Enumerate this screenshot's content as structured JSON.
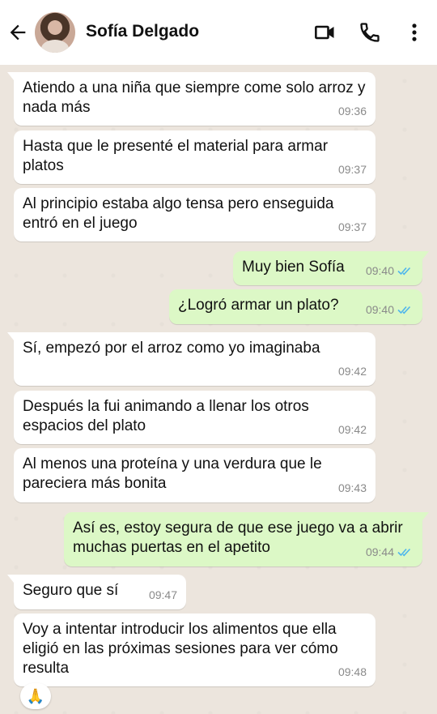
{
  "contact": {
    "name": "Sofía Delgado"
  },
  "messages": [
    {
      "text": "Atiendo a una niña que siempre come solo arroz y nada más",
      "time": "09:36"
    },
    {
      "text": "Hasta que le presenté el material para armar platos",
      "time": "09:37"
    },
    {
      "text": "Al principio estaba algo tensa pero enseguida entró en el juego",
      "time": "09:37"
    },
    {
      "text": "Muy bien Sofía",
      "time": "09:40"
    },
    {
      "text": "¿Logró armar un plato?",
      "time": "09:40"
    },
    {
      "text": "Sí, empezó por el arroz como yo imaginaba",
      "time": "09:42"
    },
    {
      "text": "Después la fui animando a llenar los otros espacios del plato",
      "time": "09:42"
    },
    {
      "text": "Al menos una proteína y una verdura que le pareciera más bonita",
      "time": "09:43"
    },
    {
      "text": "Así es, estoy segura de que ese juego va a abrir muchas puertas en el apetito",
      "time": "09:44"
    },
    {
      "text": "Seguro que sí",
      "time": "09:47"
    },
    {
      "text": "Voy a intentar introducir los alimentos que ella eligió en las próximas sesiones para ver cómo resulta",
      "time": "09:48"
    }
  ],
  "reaction": {
    "emoji": "🙏"
  },
  "colors": {
    "incoming": "#ffffff",
    "outgoing": "#dcf8c6",
    "read_ticks": "#4fb6ec",
    "background": "#ece5dd"
  },
  "icons": {
    "back": "arrow-left-icon",
    "video": "video-call-icon",
    "call": "phone-icon",
    "menu": "more-vertical-icon"
  }
}
